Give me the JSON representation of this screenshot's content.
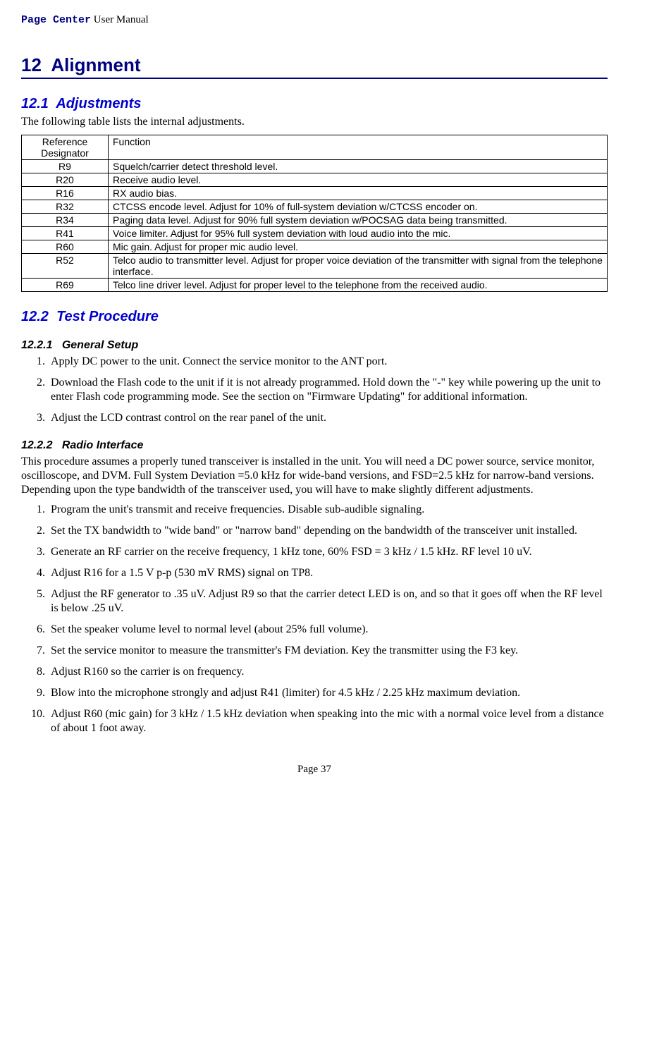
{
  "header": {
    "product": "Page Center",
    "suffix": " User Manual"
  },
  "chapter": {
    "num": "12",
    "title": "Alignment"
  },
  "sec1": {
    "num": "12.1",
    "title": "Adjustments",
    "intro": "The following table lists the internal adjustments.",
    "table": {
      "h1": "Reference Designator",
      "h2": "Function",
      "rows": [
        {
          "ref": "R9",
          "func": "Squelch/carrier detect threshold level."
        },
        {
          "ref": "R20",
          "func": "Receive audio level."
        },
        {
          "ref": "R16",
          "func": "RX audio bias."
        },
        {
          "ref": "R32",
          "func": "CTCSS encode level.  Adjust for 10% of full-system deviation w/CTCSS encoder on."
        },
        {
          "ref": "R34",
          "func": "Paging data level.  Adjust for 90% full system deviation w/POCSAG data being transmitted."
        },
        {
          "ref": "R41",
          "func": "Voice limiter.  Adjust for 95% full system deviation with loud audio into the mic."
        },
        {
          "ref": "R60",
          "func": "Mic gain.  Adjust for proper mic audio level."
        },
        {
          "ref": "R52",
          "func": "Telco audio to transmitter level.  Adjust for proper voice deviation of the transmitter with signal from the telephone interface."
        },
        {
          "ref": "R69",
          "func": "Telco line driver level.  Adjust for proper level to the telephone from the received audio."
        }
      ]
    }
  },
  "sec2": {
    "num": "12.2",
    "title": "Test Procedure",
    "sub1": {
      "num": "12.2.1",
      "title": "General Setup",
      "items": [
        "Apply DC power to the unit.  Connect the service monitor to the ANT port.",
        "Download the Flash code to the unit if it is not already programmed.  Hold down the \"-\" key while powering up the unit to enter Flash code programming mode.  See the section on \"Firmware Updating\" for additional information.",
        "Adjust the LCD contrast control on the rear panel of the unit."
      ]
    },
    "sub2": {
      "num": "12.2.2",
      "title": "Radio Interface",
      "intro": "This procedure assumes a properly tuned transceiver is installed in the unit.  You will need a DC power source, service monitor, oscilloscope, and DVM.  Full System Deviation =5.0 kHz for wide-band versions, and FSD=2.5 kHz for narrow-band versions.  Depending upon the type bandwidth of the transceiver used, you will have to make slightly different adjustments.",
      "items": [
        "Program the unit's transmit and receive frequencies.  Disable sub-audible signaling.",
        "Set the TX bandwidth to \"wide band\" or \"narrow band\" depending on the bandwidth of the transceiver unit installed.",
        "Generate an RF carrier on the receive frequency, 1 kHz tone, 60% FSD = 3 kHz / 1.5 kHz.  RF level 10 uV.",
        "Adjust R16 for a 1.5 V p-p (530 mV RMS) signal on TP8.",
        "Adjust the RF generator to .35 uV.  Adjust R9 so that the carrier detect LED is on, and so that it goes off when the RF level is below .25 uV.",
        "Set the speaker volume level to normal level (about 25% full volume).",
        "Set the service monitor to measure the transmitter's FM deviation.  Key the transmitter using the F3 key.",
        "Adjust R160 so the carrier is on frequency.",
        "Blow into the microphone strongly and adjust R41 (limiter) for 4.5 kHz / 2.25 kHz maximum deviation.",
        "Adjust R60 (mic gain) for 3 kHz / 1.5 kHz deviation when speaking into the mic with a normal voice level from a distance of about 1 foot away."
      ]
    }
  },
  "footer": {
    "page": "Page 37"
  }
}
